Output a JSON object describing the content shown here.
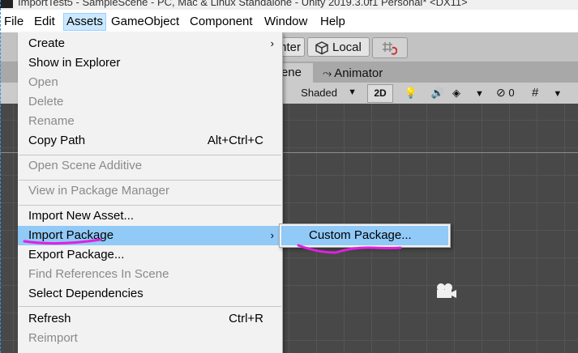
{
  "window": {
    "title": "ImportTest5 - SampleScene - PC, Mac & Linux Standalone - Unity 2019.3.0f1 Personal* <DX11>"
  },
  "menubar": {
    "items": [
      "File",
      "Edit",
      "Assets",
      "GameObject",
      "Component",
      "Window",
      "Help"
    ]
  },
  "toolbar": {
    "pivot_label": "Center",
    "space_label": "Local"
  },
  "tabs": {
    "scene_label": "Scene",
    "animator_label": "Animator"
  },
  "scene_toolbar": {
    "draw_mode": "Shaded",
    "mode_2d": "2D",
    "hidden_count": "0"
  },
  "assets_menu": {
    "create": "Create",
    "show_in_explorer": "Show in Explorer",
    "open": "Open",
    "delete": "Delete",
    "rename": "Rename",
    "copy_path": "Copy Path",
    "copy_path_shortcut": "Alt+Ctrl+C",
    "open_scene_additive": "Open Scene Additive",
    "view_in_package_manager": "View in Package Manager",
    "import_new_asset": "Import New Asset...",
    "import_package": "Import Package",
    "export_package": "Export Package...",
    "find_references": "Find References In Scene",
    "select_dependencies": "Select Dependencies",
    "refresh": "Refresh",
    "refresh_shortcut": "Ctrl+R",
    "reimport": "Reimport"
  },
  "import_package_submenu": {
    "custom_package": "Custom Package..."
  },
  "colors": {
    "highlight": "#91c9f7",
    "annotation": "#e020e0",
    "scene_bg": "#484848"
  }
}
